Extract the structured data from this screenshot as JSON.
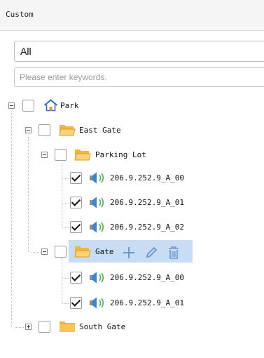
{
  "header": {
    "title": "Custom"
  },
  "filter": {
    "selected": "All"
  },
  "search": {
    "placeholder": "Please enter keywords."
  },
  "tree": {
    "park": {
      "label": "Park"
    },
    "east_gate": {
      "label": "East Gate"
    },
    "parking_lot": {
      "label": "Parking Lot",
      "devices": [
        "206.9.252.9_A_00",
        "206.9.252.9_A_01",
        "206.9.252.9_A_02"
      ]
    },
    "gate": {
      "label": "Gate",
      "devices": [
        "206.9.252.9_A_00",
        "206.9.252.9_A_01"
      ]
    },
    "south_gate": {
      "label": "South Gate"
    }
  },
  "colors": {
    "folder": "#f4b53f",
    "highlight": "#c8dcf4",
    "home": "#2f6fb5",
    "speaker": "#3a86d0"
  },
  "icons": [
    "home-icon",
    "folder-icon",
    "speaker-icon",
    "add-icon",
    "edit-icon",
    "delete-icon"
  ]
}
